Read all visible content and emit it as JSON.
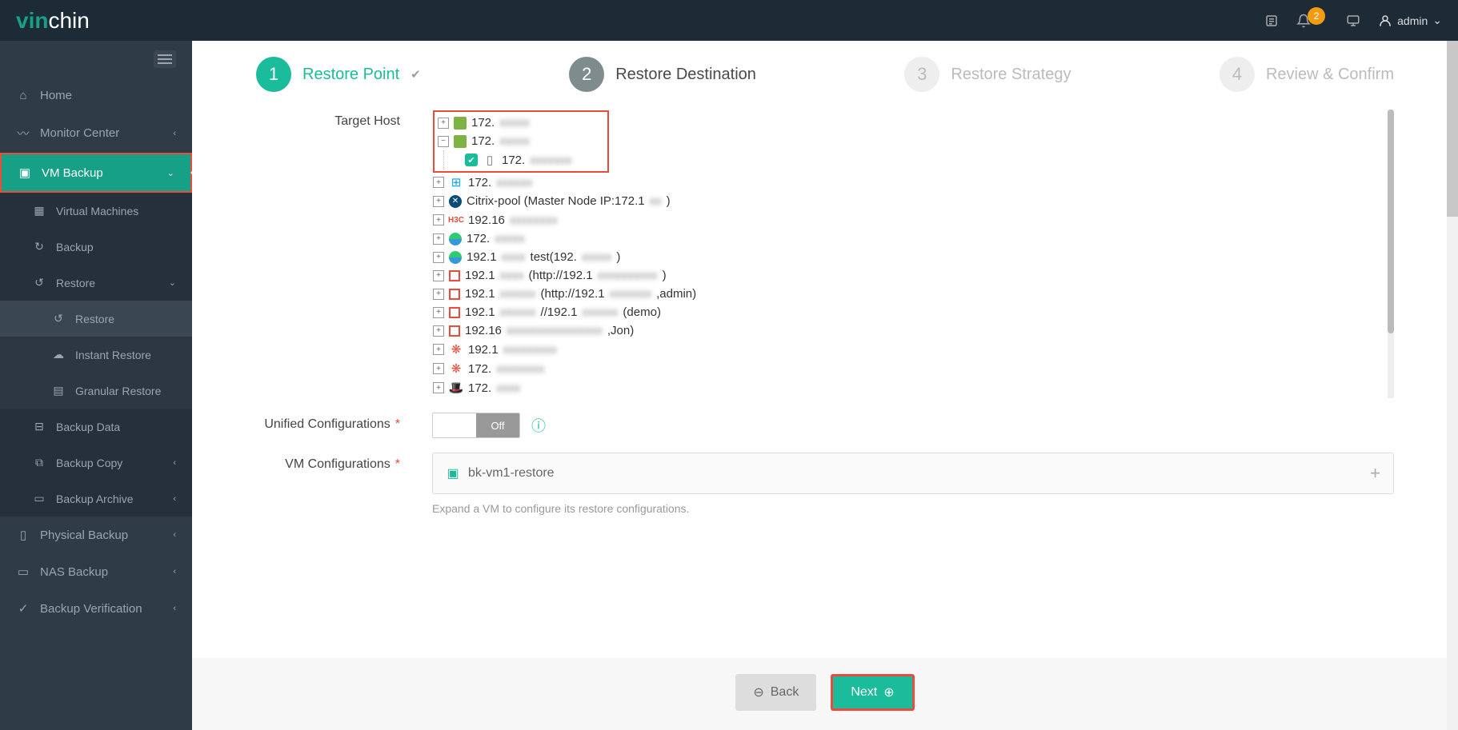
{
  "header": {
    "logo_prefix": "vin",
    "logo_suffix": "chin",
    "notif_count": "2",
    "user_name": "admin"
  },
  "sidebar": {
    "items": {
      "home": "Home",
      "monitor": "Monitor Center",
      "vm_backup": "VM Backup",
      "virtual_machines": "Virtual Machines",
      "backup": "Backup",
      "restore": "Restore",
      "restore_sub": "Restore",
      "instant_restore": "Instant Restore",
      "granular_restore": "Granular Restore",
      "backup_data": "Backup Data",
      "backup_copy": "Backup Copy",
      "backup_archive": "Backup Archive",
      "physical_backup": "Physical Backup",
      "nas_backup": "NAS Backup",
      "backup_verification": "Backup Verification"
    }
  },
  "steps": {
    "s1": {
      "num": "1",
      "label": "Restore Point"
    },
    "s2": {
      "num": "2",
      "label": "Restore Destination"
    },
    "s3": {
      "num": "3",
      "label": "Restore Strategy"
    },
    "s4": {
      "num": "4",
      "label": "Review & Confirm"
    }
  },
  "form": {
    "target_host_label": "Target Host",
    "unified_label": "Unified Configurations",
    "vm_config_label": "VM Configurations",
    "toggle_off": "Off",
    "vm_name": "bk-vm1-restore",
    "hint": "Expand a VM to configure its restore configurations."
  },
  "tree": {
    "n1": "172.",
    "n2": "172.",
    "n2_child": "172.",
    "n3": "172.",
    "n4": "Citrix-pool (Master Node IP:172.1",
    "n4_suffix": ")",
    "n5_pre": "H3C",
    "n5": "192.16",
    "n6": "172.",
    "n7": "192.1",
    "n7_mid": "test(192.",
    "n7_suf": ")",
    "n8": "192.1",
    "n8_mid": "(http://192.1",
    "n8_suf": ")",
    "n9": "192.1",
    "n9_mid": "(http://192.1",
    "n9_suf": ",admin)",
    "n10": "192.1",
    "n10_mid": "//192.1",
    "n10_suf": "(demo)",
    "n11": "192.16",
    "n11_suf": ",Jon)",
    "n12": "192.1",
    "n13": "172.",
    "n14": "172."
  },
  "buttons": {
    "back": "Back",
    "next": "Next"
  }
}
